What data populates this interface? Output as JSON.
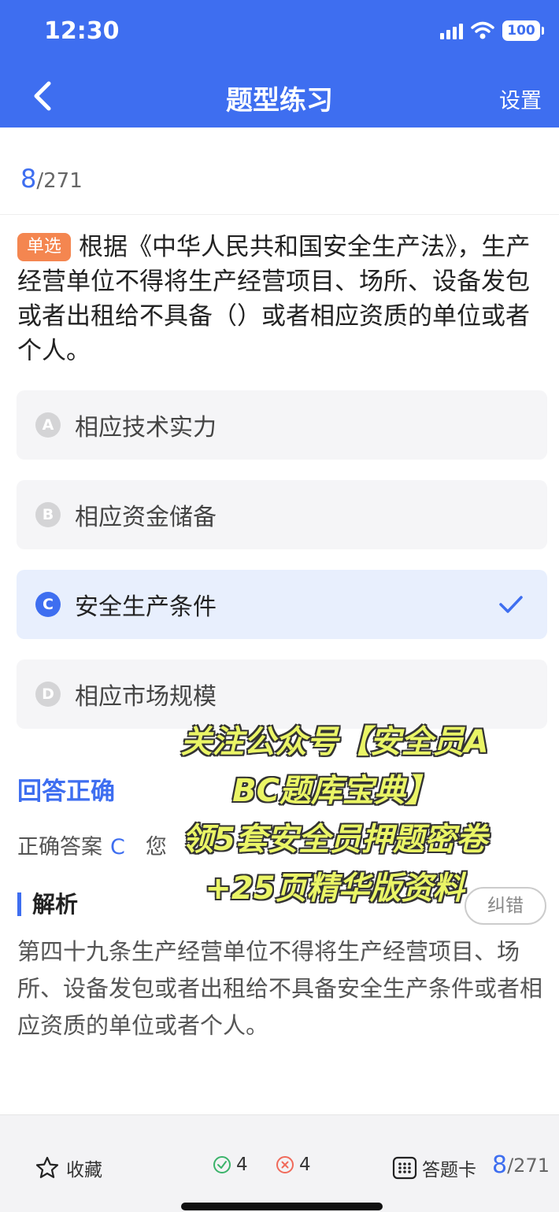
{
  "status_bar": {
    "time": "12:30",
    "battery": "100"
  },
  "nav": {
    "title": "题型练习",
    "settings": "设置"
  },
  "progress": {
    "current": "8",
    "total": "/271"
  },
  "question": {
    "type": "单选",
    "text": "根据《中华人民共和国安全生产法》，生产经营单位不得将生产经营项目、场所、设备发包或者出租给不具备（）或者相应资质的单位或者个人。"
  },
  "options": [
    {
      "letter": "A",
      "text": "相应技术实力",
      "selected": false
    },
    {
      "letter": "B",
      "text": "相应资金储备",
      "selected": false
    },
    {
      "letter": "C",
      "text": "安全生产条件",
      "selected": true
    },
    {
      "letter": "D",
      "text": "相应市场规模",
      "selected": false
    }
  ],
  "result": {
    "status": "回答正确",
    "correct_label": "正确答案",
    "correct_value": "C",
    "your_label": "您"
  },
  "analysis": {
    "title": "解析",
    "report_button": "纠错",
    "text": "第四十九条生产经营单位不得将生产经营项目、场所、设备发包或者出租给不具备安全生产条件或者相应资质的单位或者个人。"
  },
  "watermark": {
    "line1": "关注公众号【安全员A",
    "line2": "BC题库宝典】",
    "line3": "领5套安全员押题密卷",
    "line4": "+25页精华版资料"
  },
  "bottom_bar": {
    "favorite": "收藏",
    "correct_count": "4",
    "wrong_count": "4",
    "answer_card": "答题卡",
    "progress_current": "8",
    "progress_total": "/271"
  },
  "colors": {
    "primary": "#3e6ef0",
    "badge": "#f48650",
    "correct": "#3bb36a",
    "wrong": "#f06a5a",
    "watermark": "#eaf566"
  }
}
